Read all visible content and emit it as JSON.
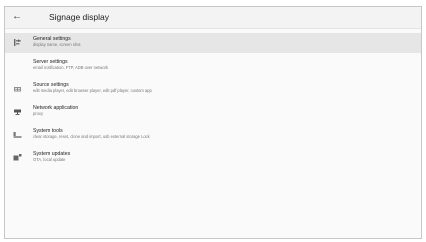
{
  "header": {
    "title": "Signage display",
    "back_icon": "arrow-left-icon"
  },
  "items": [
    {
      "label": "General settings",
      "subtitle": "display name, screen shot",
      "icon": "sliders-icon",
      "selected": true
    },
    {
      "label": "Server settings",
      "subtitle": "email notification, FTP, ADB over network",
      "icon": "none",
      "selected": false
    },
    {
      "label": "Source settings",
      "subtitle": "edit media player, edit browser player, edit pdf player, custom app",
      "icon": "grid-icon",
      "selected": false
    },
    {
      "label": "Network application",
      "subtitle": "proxy",
      "icon": "network-icon",
      "selected": false
    },
    {
      "label": "System tools",
      "subtitle": "clear storage, reset, clone and import, usb external storage Lock",
      "icon": "tools-icon",
      "selected": false
    },
    {
      "label": "System updates",
      "subtitle": "OTA, local update",
      "icon": "update-icon",
      "selected": false
    }
  ],
  "colors": {
    "selected_bg": "#e6e6e6",
    "header_bg": "#f3f3f3",
    "icon": "#666666"
  }
}
